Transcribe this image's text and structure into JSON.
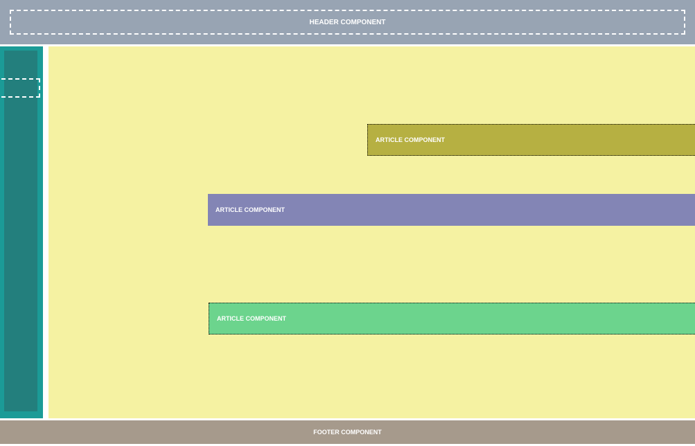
{
  "header": {
    "label": "HEADER COMPONENT"
  },
  "sidebar": {},
  "main": {
    "articles": [
      {
        "label": "ARTICLE COMPONENT"
      },
      {
        "label": "ARTICLE COMPONENT"
      },
      {
        "label": "ARTICLE COMPONENT"
      }
    ]
  },
  "footer": {
    "label": "FOOTER COMPONENT"
  }
}
